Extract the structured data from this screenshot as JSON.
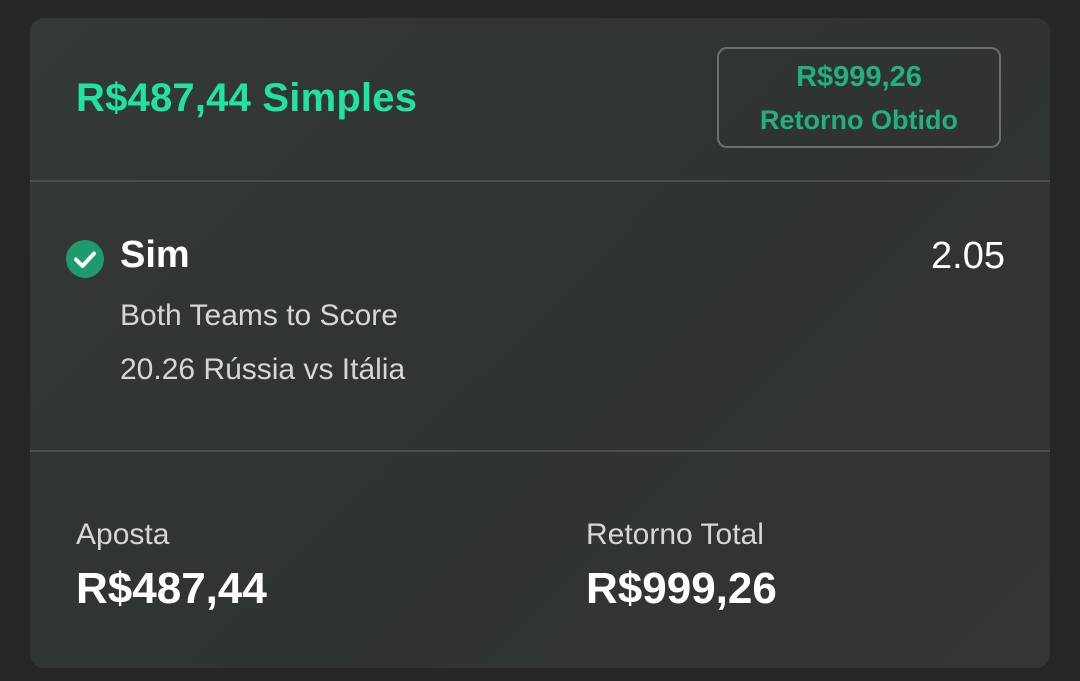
{
  "header": {
    "title": "R$487,44 Simples",
    "cashout": {
      "amount": "R$999,26",
      "label": "Retorno Obtido"
    }
  },
  "selection": {
    "status_icon": "check-circle-icon",
    "name": "Sim",
    "odds": "2.05",
    "market": "Both Teams to Score",
    "event": "20.26 Rússia vs Itália"
  },
  "footer": {
    "stake_label": "Aposta",
    "stake_value": "R$487,44",
    "return_label": "Retorno Total",
    "return_value": "R$999,26"
  },
  "colors": {
    "accent": "#20e3a2",
    "cashout_text": "#22b07c",
    "check_bg": "#1f9a6d",
    "background": "#262626",
    "card": "#323634"
  }
}
